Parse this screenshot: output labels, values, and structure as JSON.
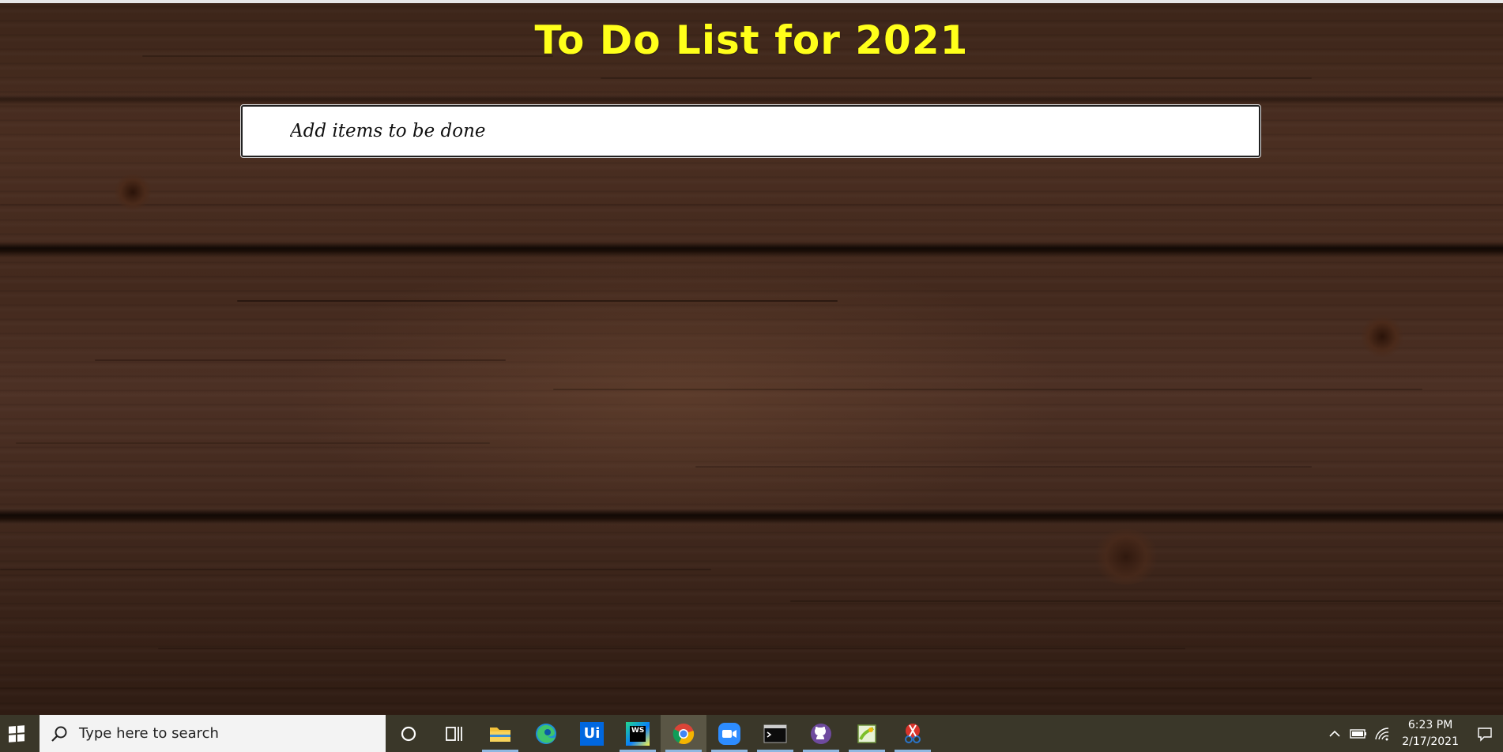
{
  "app": {
    "title": "To Do List for 2021",
    "input_placeholder": "Add items to be done",
    "title_color": "#ffff1a"
  },
  "taskbar": {
    "search_placeholder": "Type here to search",
    "pinned_apps": [
      {
        "name": "Cortana",
        "icon": "circle-icon"
      },
      {
        "name": "Task View",
        "icon": "task-view-icon"
      },
      {
        "name": "File Explorer",
        "icon": "folder-icon"
      },
      {
        "name": "Microsoft Edge",
        "icon": "edge-icon"
      },
      {
        "name": "UiPath",
        "icon": "uipath-icon",
        "label": "Ui"
      },
      {
        "name": "WebStorm",
        "icon": "webstorm-icon",
        "label": "WS"
      },
      {
        "name": "Google Chrome",
        "icon": "chrome-icon"
      },
      {
        "name": "Zoom",
        "icon": "zoom-icon"
      },
      {
        "name": "Terminal",
        "icon": "terminal-icon"
      },
      {
        "name": "GitHub Desktop",
        "icon": "github-icon"
      },
      {
        "name": "Notepad++",
        "icon": "notepad-plus-icon"
      },
      {
        "name": "Snipping Tool",
        "icon": "scissors-icon"
      }
    ],
    "clock_time": "6:23 PM",
    "clock_date": "2/17/2021"
  }
}
